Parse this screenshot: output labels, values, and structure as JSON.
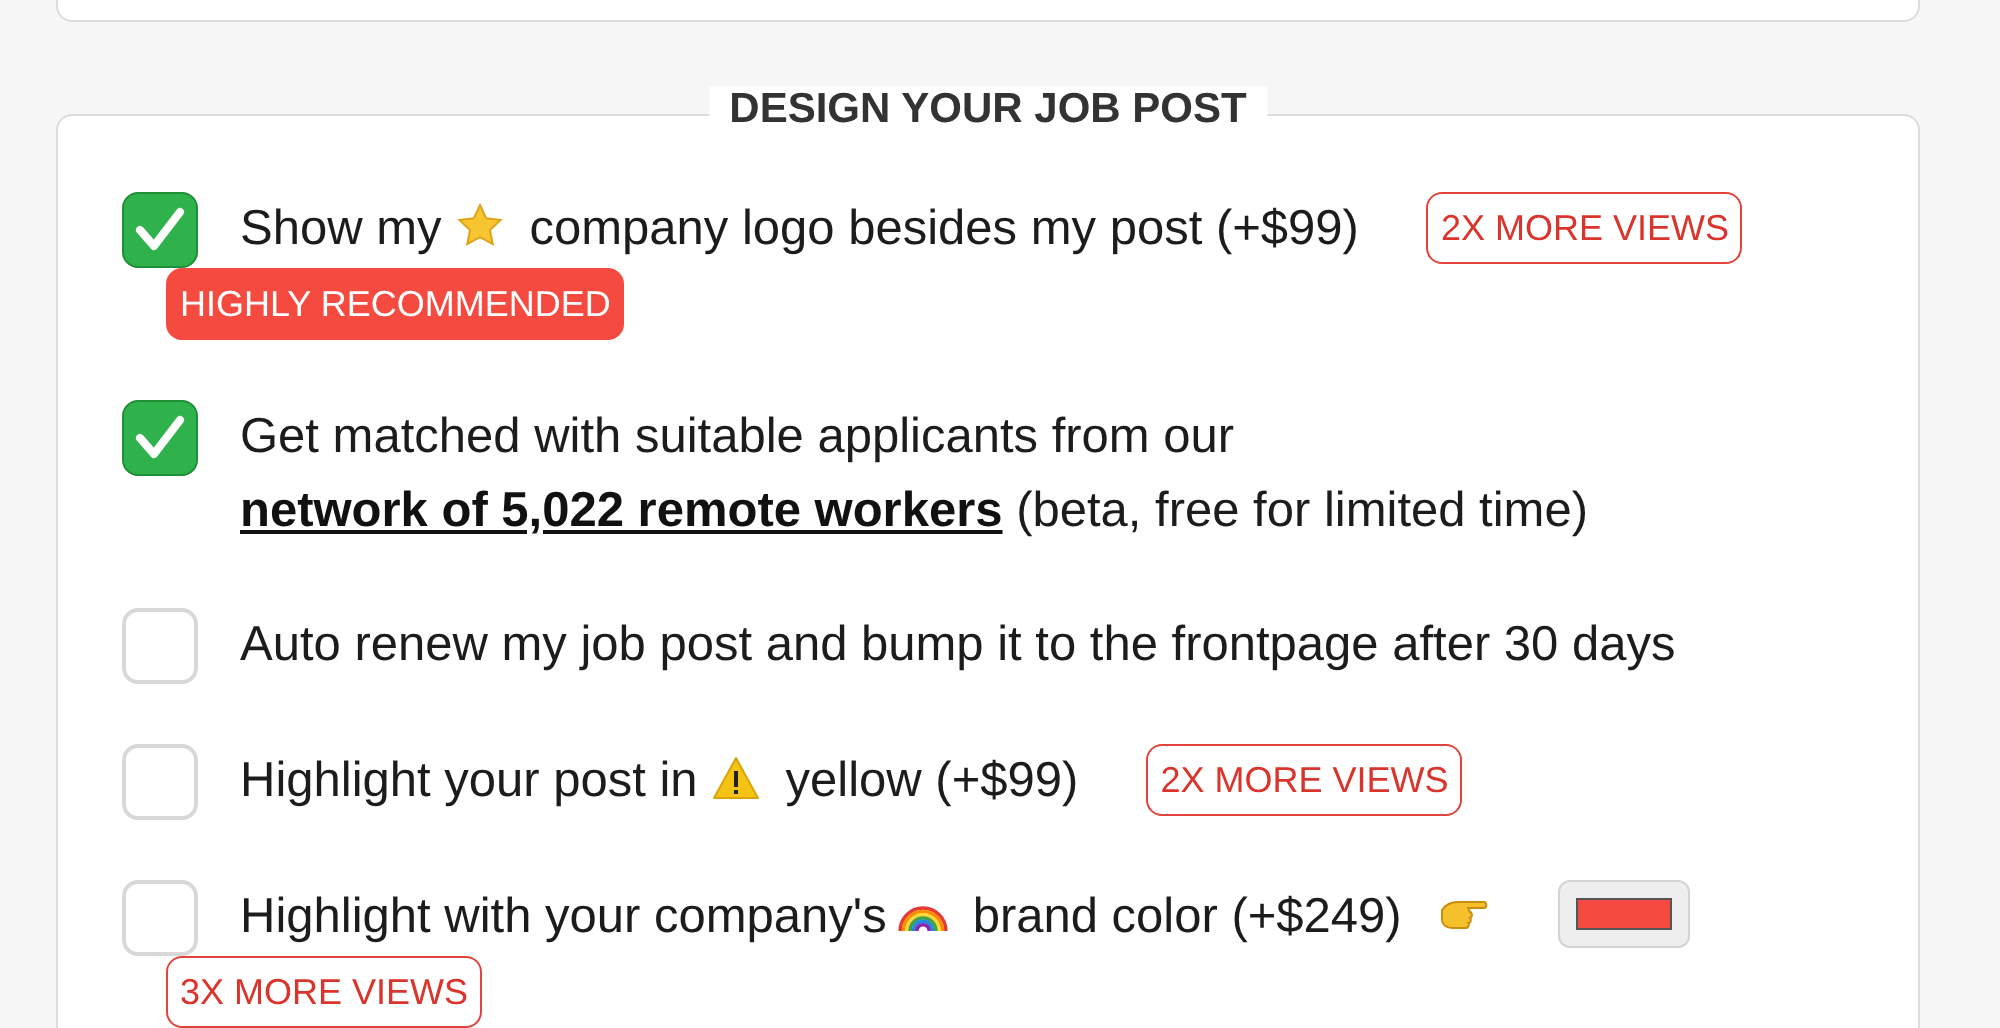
{
  "section": {
    "title": "DESIGN YOUR JOB POST"
  },
  "options": [
    {
      "checked": true,
      "segments": [
        {
          "kind": "text",
          "text": "Show my"
        },
        {
          "kind": "star"
        },
        {
          "kind": "text",
          "text": "company logo besides my post (+$99)"
        }
      ],
      "tag": {
        "text": "2X MORE VIEWS",
        "kind": "outline"
      },
      "tag_below": {
        "text": "HIGHLY RECOMMENDED",
        "kind": "filled"
      }
    },
    {
      "checked": true,
      "segments": [
        {
          "kind": "text",
          "text": "Get matched with suitable applicants from our "
        },
        {
          "kind": "link",
          "text": "network of 5,022 remote workers"
        },
        {
          "kind": "text",
          "text": " (beta, free for limited time)"
        }
      ]
    },
    {
      "checked": false,
      "segments": [
        {
          "kind": "text",
          "text": "Auto renew my job post and bump it to the frontpage after 30 days"
        }
      ]
    },
    {
      "checked": false,
      "segments": [
        {
          "kind": "text",
          "text": "Highlight your post in"
        },
        {
          "kind": "warning"
        },
        {
          "kind": "text",
          "text": "yellow (+$99)"
        }
      ],
      "tag": {
        "text": "2X MORE VIEWS",
        "kind": "outline"
      }
    },
    {
      "checked": false,
      "segments": [
        {
          "kind": "text",
          "text": "Highlight with your company's"
        },
        {
          "kind": "rainbow"
        },
        {
          "kind": "text",
          "text": "brand color (+$249)"
        },
        {
          "kind": "pointing-hand"
        },
        {
          "kind": "swatch",
          "color": "#f44a40"
        }
      ],
      "tag_below": {
        "text": "3X MORE VIEWS",
        "kind": "outline"
      }
    }
  ]
}
